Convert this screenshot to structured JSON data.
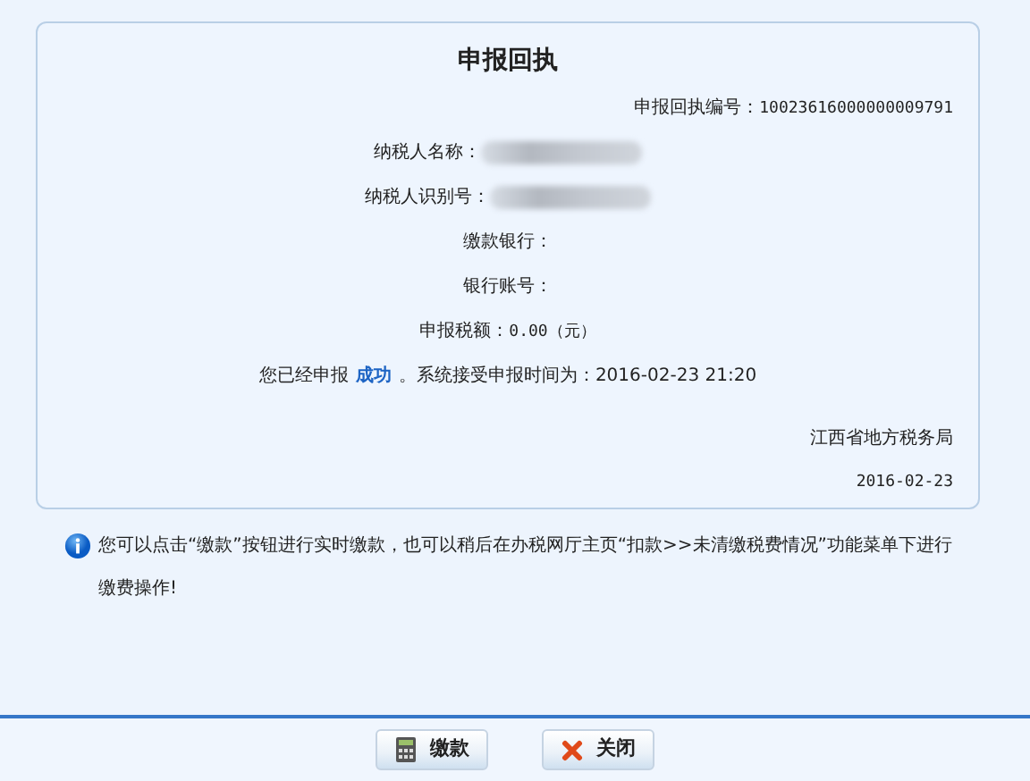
{
  "title": "申报回执",
  "receipt_number": {
    "label": "申报回执编号：",
    "value": "10023616000000009791"
  },
  "fields": [
    {
      "label": "纳税人名称：",
      "kind": "redacted"
    },
    {
      "label": "纳税人识别号：",
      "kind": "redacted"
    },
    {
      "label": "缴款银行：",
      "kind": "text"
    },
    {
      "label": "银行账号：",
      "kind": "text"
    },
    {
      "label": "申报税额：",
      "kind": "text",
      "value": "0.00（元）"
    }
  ],
  "status_line": {
    "prefix": "您已经申报",
    "status": "成功",
    "suffix": "。系统接受申报时间为：2016-02-23 21:20"
  },
  "issuer": "江西省地方税务局",
  "issue_date": "2016-02-23",
  "notice": "您可以点击“缴款”按钮进行实时缴款，也可以稍后在办税网厅主页“扣款>>未清缴税费情况”功能菜单下进行缴费操作!",
  "buttons": [
    {
      "label": "缴款",
      "kind": "calculator"
    },
    {
      "label": "关闭",
      "kind": "close"
    }
  ]
}
